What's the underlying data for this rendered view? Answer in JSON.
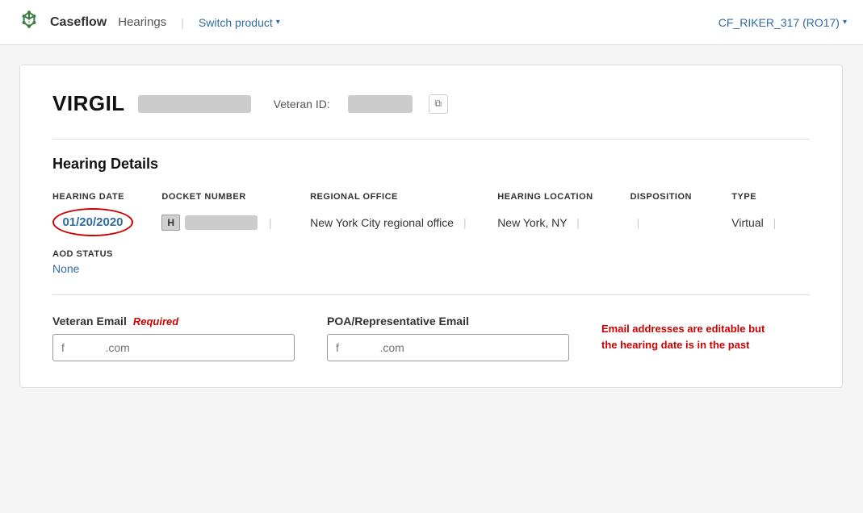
{
  "navbar": {
    "brand": "Caseflow",
    "product": "Hearings",
    "divider": "|",
    "switch_product_label": "Switch product",
    "user_label": "CF_RIKER_317 (RO17)",
    "chevron_down": "▾"
  },
  "veteran": {
    "name": "VIRGIL",
    "name_redacted_placeholder": "",
    "id_label": "Veteran ID:",
    "id_redacted_placeholder": "",
    "copy_icon_label": "⧉"
  },
  "hearing_details": {
    "section_title": "Hearing Details",
    "columns": {
      "hearing_date": "HEARING DATE",
      "docket_number": "DOCKET NUMBER",
      "regional_office": "REGIONAL OFFICE",
      "hearing_location": "HEARING LOCATION",
      "disposition": "DISPOSITION",
      "type": "TYPE"
    },
    "row": {
      "date": "01/20/2020",
      "docket_badge": "H",
      "docket_redacted": "",
      "regional_office": "New York City regional office",
      "hearing_location": "New York, NY",
      "disposition": "",
      "type": "Virtual"
    },
    "aod_status_label": "AOD STATUS",
    "aod_status_value": "None"
  },
  "emails": {
    "veteran_email_label": "Veteran Email",
    "required_label": "Required",
    "veteran_email_placeholder": "f             .com",
    "poa_email_label": "POA/Representative Email",
    "poa_email_placeholder": "f             .com",
    "warning_message": "Email addresses are editable but the hearing date is in the past"
  }
}
